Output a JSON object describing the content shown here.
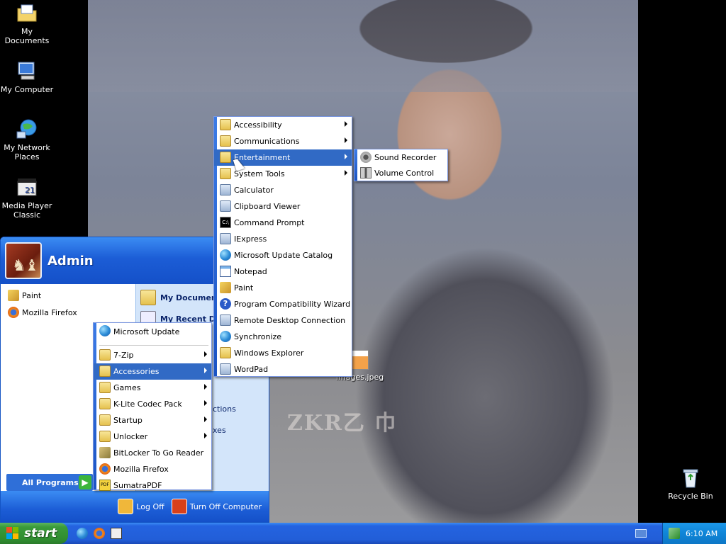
{
  "desktop": {
    "icons": [
      {
        "label": "My Documents",
        "icon": "my-documents-icon"
      },
      {
        "label": "My Computer",
        "icon": "my-computer-icon"
      },
      {
        "label": "My Network Places",
        "icon": "network-places-icon"
      },
      {
        "label": "Media Player Classic",
        "icon": "media-player-icon"
      },
      {
        "label": "Recycle Bin",
        "icon": "recycle-bin-icon"
      },
      {
        "label": "images.jpeg",
        "icon": "image-file-icon"
      }
    ],
    "wallpaper_text": "ZKR乙 巾"
  },
  "start_menu": {
    "user": "Admin",
    "pinned": [
      {
        "label": "Paint",
        "icon": "paint-icon"
      },
      {
        "label": "Mozilla Firefox",
        "icon": "firefox-icon"
      }
    ],
    "right": [
      {
        "label": "My Documents",
        "icon": "my-documents-icon"
      },
      {
        "label": "My Recent Do",
        "icon": "recent-documents-icon"
      }
    ],
    "right_partial": [
      "ctions",
      "xes"
    ],
    "all_programs": "All Programs",
    "log_off": "Log Off",
    "turn_off": "Turn Off Computer"
  },
  "programs_menu": [
    {
      "label": "Microsoft Update",
      "icon": "update-icon",
      "submenu": false
    },
    {
      "label": "7-Zip",
      "icon": "folder-icon",
      "submenu": true
    },
    {
      "label": "Accessories",
      "icon": "folder-icon",
      "submenu": true,
      "selected": true
    },
    {
      "label": "Games",
      "icon": "folder-icon",
      "submenu": true
    },
    {
      "label": "K-Lite Codec Pack",
      "icon": "folder-icon",
      "submenu": true
    },
    {
      "label": "Startup",
      "icon": "folder-icon",
      "submenu": true
    },
    {
      "label": "Unlocker",
      "icon": "folder-icon",
      "submenu": true
    },
    {
      "label": "BitLocker To Go Reader",
      "icon": "bitlocker-icon",
      "submenu": false
    },
    {
      "label": "Mozilla Firefox",
      "icon": "firefox-icon",
      "submenu": false
    },
    {
      "label": "SumatraPDF",
      "icon": "pdf-icon",
      "submenu": false
    }
  ],
  "accessories_menu": [
    {
      "label": "Accessibility",
      "icon": "folder-icon",
      "submenu": true
    },
    {
      "label": "Communications",
      "icon": "folder-icon",
      "submenu": true
    },
    {
      "label": "Entertainment",
      "icon": "folder-icon",
      "submenu": true,
      "selected": true
    },
    {
      "label": "System Tools",
      "icon": "folder-icon",
      "submenu": true
    },
    {
      "label": "Calculator",
      "icon": "calculator-icon",
      "submenu": false
    },
    {
      "label": "Clipboard Viewer",
      "icon": "clipboard-icon",
      "submenu": false
    },
    {
      "label": "Command Prompt",
      "icon": "command-prompt-icon",
      "submenu": false
    },
    {
      "label": "IExpress",
      "icon": "iexpress-icon",
      "submenu": false
    },
    {
      "label": "Microsoft Update Catalog",
      "icon": "globe-icon",
      "submenu": false
    },
    {
      "label": "Notepad",
      "icon": "notepad-icon",
      "submenu": false
    },
    {
      "label": "Paint",
      "icon": "paint-icon",
      "submenu": false
    },
    {
      "label": "Program Compatibility Wizard",
      "icon": "help-icon",
      "submenu": false
    },
    {
      "label": "Remote Desktop Connection",
      "icon": "remote-desktop-icon",
      "submenu": false
    },
    {
      "label": "Synchronize",
      "icon": "sync-icon",
      "submenu": false
    },
    {
      "label": "Windows Explorer",
      "icon": "explorer-icon",
      "submenu": false
    },
    {
      "label": "WordPad",
      "icon": "wordpad-icon",
      "submenu": false
    }
  ],
  "entertainment_menu": [
    {
      "label": "Sound Recorder",
      "icon": "sound-recorder-icon"
    },
    {
      "label": "Volume Control",
      "icon": "volume-control-icon"
    }
  ],
  "taskbar": {
    "start_label": "start",
    "clock": "6:10 AM"
  },
  "colors": {
    "selection": "#316ac5",
    "taskbar": "#225ed8",
    "start_button": "#3a9b3a"
  }
}
